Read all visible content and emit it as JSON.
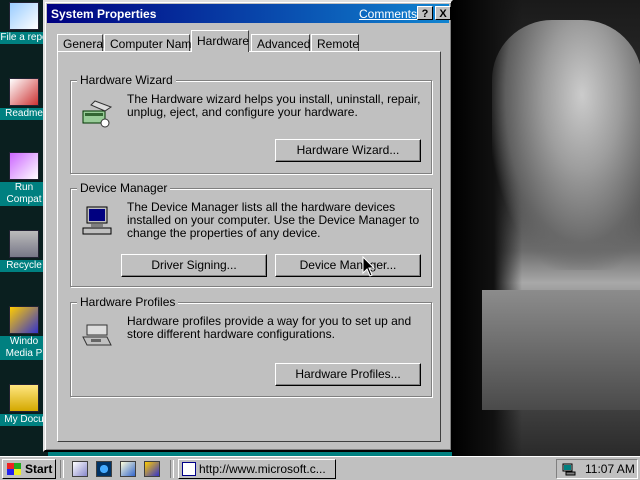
{
  "desktop": {
    "icons": [
      {
        "label": "File a repo",
        "icon": "document-icon"
      },
      {
        "label": "Readme",
        "icon": "readme-icon"
      },
      {
        "label": "Run Compat",
        "icon": "compat-icon"
      },
      {
        "label": "Recycle",
        "icon": "recycle-bin-icon"
      },
      {
        "label": "Windo Media P",
        "icon": "media-player-icon"
      },
      {
        "label": "My Docu",
        "icon": "folder-icon"
      }
    ]
  },
  "dialog": {
    "title": "System Properties",
    "comments_link": "Comments?",
    "help_button": "?",
    "close_button": "X",
    "tabs": [
      {
        "label": "General",
        "active": false
      },
      {
        "label": "Computer Name",
        "active": false
      },
      {
        "label": "Hardware",
        "active": true
      },
      {
        "label": "Advanced",
        "active": false
      },
      {
        "label": "Remote",
        "active": false
      }
    ],
    "hardware_wizard": {
      "legend": "Hardware Wizard",
      "description": "The Hardware wizard helps you install, uninstall, repair, unplug, eject, and configure your hardware.",
      "button": "Hardware Wizard...",
      "icon": "hardware-wizard-icon"
    },
    "device_manager": {
      "legend": "Device Manager",
      "description": "The Device Manager lists all the hardware devices installed on your computer. Use the Device Manager to change the properties of any device.",
      "driver_signing_button": "Driver Signing...",
      "device_manager_button": "Device Manager...",
      "icon": "computer-icon"
    },
    "hardware_profiles": {
      "legend": "Hardware Profiles",
      "description": "Hardware profiles provide a way for you to set up and store different hardware configurations.",
      "button": "Hardware Profiles...",
      "icon": "hardware-profiles-icon"
    }
  },
  "taskbar": {
    "start_label": "Start",
    "quick_launch": [
      "show-desktop-icon",
      "internet-explorer-icon",
      "outlook-express-icon",
      "media-player-icon"
    ],
    "task_button": "http://www.microsoft.c...",
    "clock": "11:07 AM"
  },
  "colors": {
    "titlebar_start": "#000080",
    "titlebar_end": "#1084d0",
    "face": "#c0c0c0",
    "desktop": "#008080"
  }
}
